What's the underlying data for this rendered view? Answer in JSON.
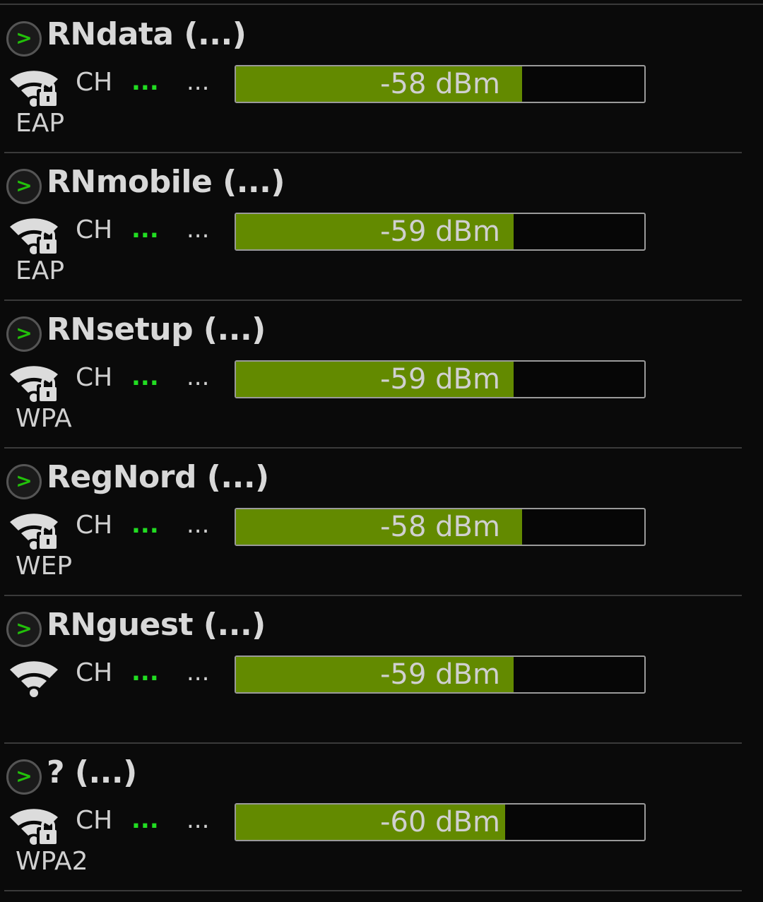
{
  "ch_label": "CH",
  "networks": [
    {
      "ssid": "RNdata (...)",
      "channel": "...",
      "frequency": "...",
      "signal": "-58 dBm",
      "signal_level_pct": 70,
      "security": "EAP",
      "locked": true
    },
    {
      "ssid": "RNmobile (...)",
      "channel": "...",
      "frequency": "...",
      "signal": "-59 dBm",
      "signal_level_pct": 68,
      "security": "EAP",
      "locked": true
    },
    {
      "ssid": "RNsetup (...)",
      "channel": "...",
      "frequency": "...",
      "signal": "-59 dBm",
      "signal_level_pct": 68,
      "security": "WPA",
      "locked": true
    },
    {
      "ssid": "RegNord (...)",
      "channel": "...",
      "frequency": "...",
      "signal": "-58 dBm",
      "signal_level_pct": 70,
      "security": "WEP",
      "locked": true
    },
    {
      "ssid": "RNguest (...)",
      "channel": "...",
      "frequency": "...",
      "signal": "-59 dBm",
      "signal_level_pct": 68,
      "security": "",
      "locked": false
    },
    {
      "ssid": "? (...)",
      "channel": "...",
      "frequency": "...",
      "signal": "-60 dBm",
      "signal_level_pct": 66,
      "security": "WPA2",
      "locked": true
    }
  ],
  "colors": {
    "background": "#0a0a0a",
    "bar_fill": "#638a00",
    "channel_text": "#22dd22",
    "chevron": "#22c00a"
  },
  "icons": {
    "expand": "chevron-right-icon",
    "wifi_locked": "wifi-lock-icon",
    "wifi_open": "wifi-icon"
  }
}
